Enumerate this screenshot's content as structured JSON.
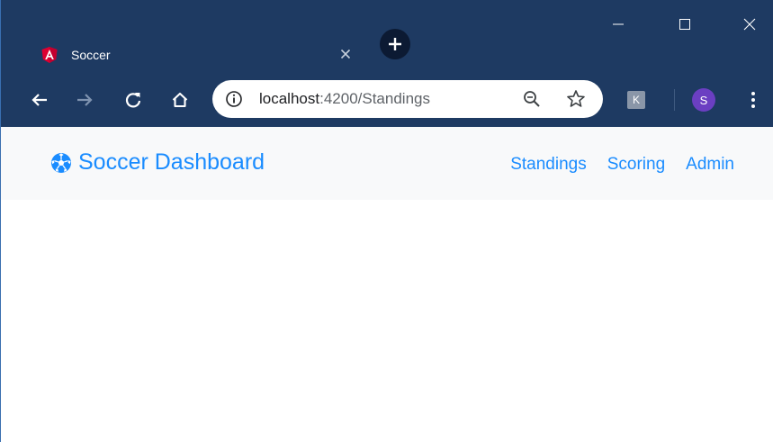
{
  "browser": {
    "tab_title": "Soccer",
    "url_host": "localhost",
    "url_path": ":4200/Standings",
    "profile_initial": "S",
    "extension_label": "K",
    "accent_color": "#1e3a62"
  },
  "app": {
    "brand_text": "Soccer Dashboard",
    "brand_icon": "soccer-ball-icon",
    "link_color": "#1a8cff",
    "nav": [
      "Standings",
      "Scoring",
      "Admin"
    ]
  }
}
